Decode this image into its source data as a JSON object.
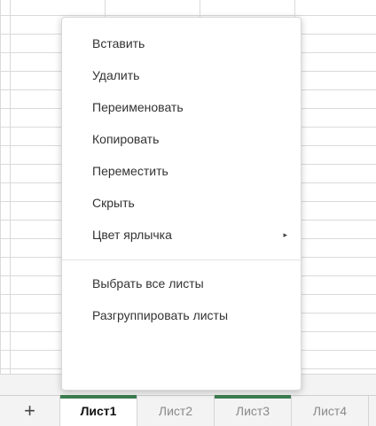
{
  "context_menu": {
    "items": [
      {
        "label": "Вставить"
      },
      {
        "label": "Удалить"
      },
      {
        "label": "Переименовать"
      },
      {
        "label": "Копировать"
      },
      {
        "label": "Переместить"
      },
      {
        "label": "Скрыть"
      },
      {
        "label": "Цвет ярлычка",
        "submenu_indicator": "▸"
      }
    ],
    "group2": [
      {
        "label": "Выбрать все листы"
      },
      {
        "label": "Разгруппировать листы"
      }
    ]
  },
  "tabbar": {
    "add_label": "+",
    "tabs": [
      {
        "label": "Лист1",
        "active": true,
        "tab_color": "#3c7d50"
      },
      {
        "label": "Лист2",
        "active": false
      },
      {
        "label": "Лист3",
        "active": false,
        "tab_color": "#3c7d50"
      },
      {
        "label": "Лист4",
        "active": false
      }
    ]
  },
  "colors": {
    "accent": "#3c7d50",
    "grid_line": "#dadada"
  }
}
